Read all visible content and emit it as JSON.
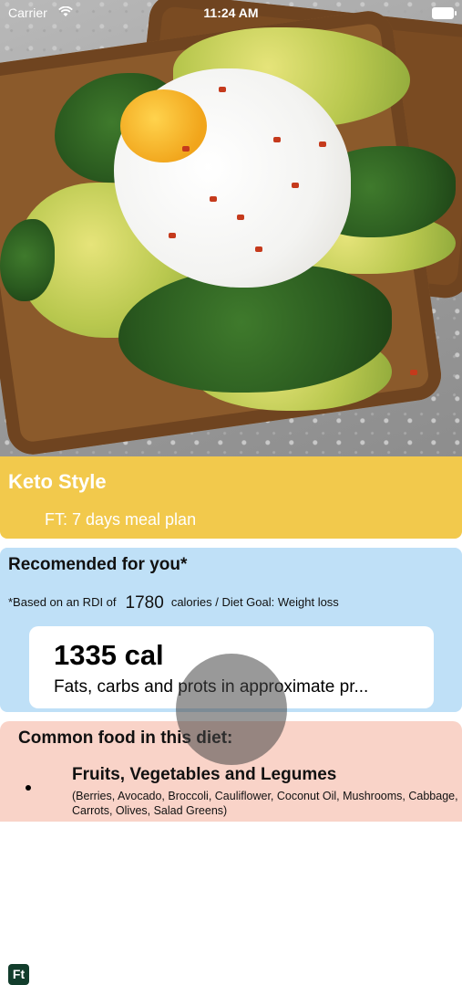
{
  "status_bar": {
    "carrier": "Carrier",
    "time": "11:24 AM"
  },
  "hero": {
    "image_subject": "poached egg on avocado toast"
  },
  "diet_card": {
    "title": "Keto Style",
    "logo_text": "Ft",
    "plan_label": "FT: 7 days meal plan",
    "color": "#f2c94c"
  },
  "recommended": {
    "title": "Recomended for you*",
    "rdi_prefix": "*Based on an RDI of",
    "rdi_value": "1780",
    "rdi_suffix": "calories / Diet Goal: Weight loss",
    "calories": "1335 cal",
    "macros_text": "Fats, carbs and prots in approximate pr...",
    "color": "#bfe0f7"
  },
  "common_food": {
    "title": "Common food in this diet:",
    "items": [
      {
        "name": "Fruits, Vegetables and Legumes",
        "details": "(Berries, Avocado, Broccoli, Cauliflower, Coconut Oil, Mushrooms, Cabbage, Carrots, Olives, Salad Greens)"
      }
    ],
    "color": "#f9d3c8"
  }
}
